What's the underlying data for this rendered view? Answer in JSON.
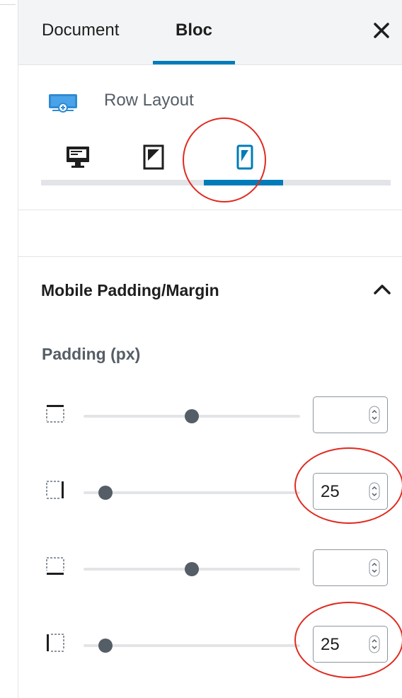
{
  "sidebar": {
    "tabs": [
      {
        "label": "Document",
        "active": false
      },
      {
        "label": "Bloc",
        "active": true
      }
    ],
    "close_icon": "close-icon"
  },
  "block": {
    "icon": "row-layout-icon",
    "title": "Row Layout",
    "devices": [
      {
        "name": "desktop",
        "icon": "desktop-icon",
        "active": false
      },
      {
        "name": "tablet",
        "icon": "tablet-icon",
        "active": false
      },
      {
        "name": "mobile",
        "icon": "mobile-icon",
        "active": true
      }
    ]
  },
  "padding_panel": {
    "title": "Mobile Padding/Margin",
    "expanded": true,
    "label": "Padding (px)",
    "rows": [
      {
        "side": "top",
        "icon": "padding-top-icon",
        "value": "",
        "slider_fraction": 0.5
      },
      {
        "side": "right",
        "icon": "padding-right-icon",
        "value": "25",
        "slider_fraction": 0.1
      },
      {
        "side": "bottom",
        "icon": "padding-bottom-icon",
        "value": "",
        "slider_fraction": 0.5
      },
      {
        "side": "left",
        "icon": "padding-left-icon",
        "value": "25",
        "slider_fraction": 0.1
      }
    ]
  },
  "colors": {
    "accent": "#007cba",
    "annotation": "#e02a1f",
    "slider_thumb": "#555d66"
  }
}
